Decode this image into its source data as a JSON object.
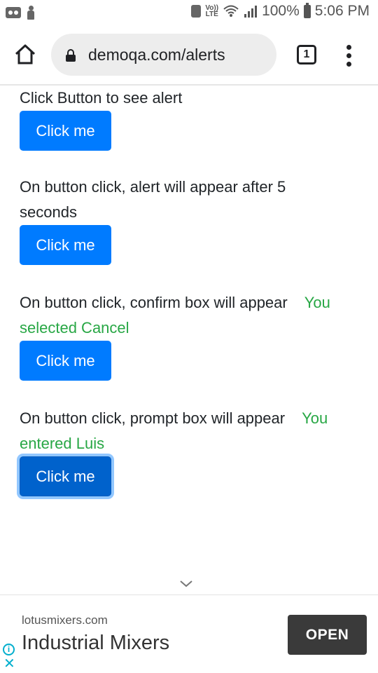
{
  "status_bar": {
    "battery_percent": "100%",
    "time": "5:06 PM",
    "network_label": "LTE",
    "volte_label": "Vo))"
  },
  "browser": {
    "url": "demoqa.com/alerts",
    "tab_count": "1"
  },
  "alerts": [
    {
      "label": "Click Button to see alert",
      "result": "",
      "button_label": "Click me"
    },
    {
      "label": "On button click, alert will appear after 5 seconds",
      "result": "",
      "button_label": "Click me"
    },
    {
      "label": "On button click, confirm box will appear",
      "result": "You selected Cancel",
      "button_label": "Click me"
    },
    {
      "label": "On button click, prompt box will appear",
      "result": "You entered Luis",
      "button_label": "Click me"
    }
  ],
  "ad": {
    "domain": "lotusmixers.com",
    "title": "Industrial Mixers",
    "cta_label": "OPEN",
    "info_icon": "i",
    "close_icon": "✕"
  },
  "colors": {
    "primary_button": "#007bff",
    "result_text": "#28a745"
  }
}
